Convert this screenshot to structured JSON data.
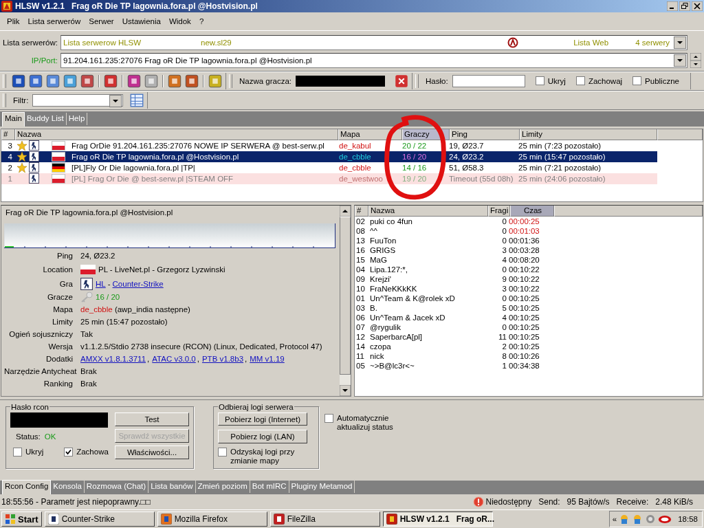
{
  "window": {
    "title": "HLSW v1.2.1   Frag oR Die TP lagownia.fora.pl @Hostvision.pl"
  },
  "menu": [
    {
      "label": "Plik"
    },
    {
      "label": "Lista serwerów"
    },
    {
      "label": "Serwer"
    },
    {
      "label": "Ustawienia"
    },
    {
      "label": "Widok"
    },
    {
      "label": "?"
    }
  ],
  "server_list": {
    "label": "Lista serwerów:",
    "name": "Lista serwerow HLSW",
    "file": "new.sl29",
    "source": "Lista Web",
    "count": "4 serwery"
  },
  "ip_port": {
    "label": "IP/Port:",
    "value": "91.204.161.235:27076 Frag oR Die TP lagownia.fora.pl @Hostvision.pl"
  },
  "toolbar": {
    "player_name_label": "Nazwa gracza:",
    "password_label": "Hasło:",
    "checkboxes": [
      {
        "label": "Ukryj",
        "checked": false
      },
      {
        "label": "Zachowaj",
        "checked": false
      },
      {
        "label": "Publiczne",
        "checked": false
      }
    ]
  },
  "filter": {
    "label": "Filtr:"
  },
  "main_tabs": [
    {
      "label": "Main",
      "selected": true
    },
    {
      "label": "Buddy List",
      "selected": false
    },
    {
      "label": "Help",
      "selected": false
    }
  ],
  "servers": {
    "columns": [
      {
        "label": "#",
        "sorted": false
      },
      {
        "label": "Nazwa",
        "sorted": false
      },
      {
        "label": "Mapa",
        "sorted": false
      },
      {
        "label": "Graczy",
        "sorted": true
      },
      {
        "label": "Ping",
        "sorted": false
      },
      {
        "label": "Limity",
        "sorted": false
      }
    ],
    "rows": [
      {
        "num": "3",
        "favorite": true,
        "flag": {
          "kind": "pl"
        },
        "name": "Frag OrDie 91.204.161.235:27076 NOWE IP SERWERA @ best-serw.pl",
        "map": "de_kabul",
        "players": "20 / 22",
        "ping": "19, Ø23.7",
        "limits": "25 min (7:23 pozostało)",
        "selected": false,
        "timeout": false
      },
      {
        "num": "4",
        "favorite": true,
        "flag": {
          "kind": "pl"
        },
        "name": "Frag oR Die TP lagownia.fora.pl @Hostvision.pl",
        "map": "de_cbble",
        "players": "16 / 20",
        "ping": "24, Ø23.2",
        "limits": "25 min (15:47 pozostało)",
        "selected": true,
        "timeout": false
      },
      {
        "num": "2",
        "favorite": true,
        "flag": {
          "kind": "de"
        },
        "name": "[PL]Fly Or Die lagownia.fora.pl |TP|",
        "map": "de_cbble",
        "players": "14 / 16",
        "ping": "51, Ø58.3",
        "limits": "25 min (7:21 pozostało)",
        "selected": false,
        "timeout": false
      },
      {
        "num": "1",
        "favorite": false,
        "flag": {
          "kind": "pl"
        },
        "name": "[PL] Frag Or Die @ best-serw.pl |STEAM OFF",
        "map": "de_westwoo",
        "players": "19 / 20",
        "ping": "Timeout (55d 08h)",
        "limits": "25 min (24:06 pozostało)",
        "selected": false,
        "timeout": true
      }
    ]
  },
  "details": {
    "title": "Frag oR Die TP lagownia.fora.pl @Hostvision.pl",
    "fields": [
      {
        "kind": "text",
        "label": "Ping",
        "value": "24, Ø23.2"
      },
      {
        "kind": "location",
        "label": "Location",
        "value": "PL - LiveNet.pl - Grzegorz Lyzwinski"
      },
      {
        "kind": "game",
        "label": "Gra",
        "links": [
          "HL",
          "Counter-Strike"
        ],
        "separator": "-"
      },
      {
        "kind": "players",
        "label": "Gracze",
        "value": "16 / 20"
      },
      {
        "kind": "map",
        "label": "Mapa",
        "map": "de_cbble",
        "value": "(awp_india następne)"
      },
      {
        "kind": "text",
        "label": "Limity",
        "value": "25 min (15:47 pozostało)"
      },
      {
        "kind": "text",
        "label": "Ogień sojuszniczy",
        "value": "Tak"
      },
      {
        "kind": "text",
        "label": "Wersja",
        "value": "v1.1.2.5/Stdio 2738 insecure (RCON) (Linux, Dedicated, Protocol 47)"
      },
      {
        "kind": "addons",
        "label": "Dodatki",
        "links": [
          "AMXX v1.8.1.3711",
          "ATAC v3.0.0",
          "PTB v1.8b3",
          "MM v1.19"
        ],
        "separator": ","
      },
      {
        "kind": "text",
        "label": "Narzędzie Antycheat",
        "value": "Brak"
      },
      {
        "kind": "text",
        "label": "Ranking",
        "value": "Brak"
      }
    ]
  },
  "players": {
    "columns": [
      {
        "label": "#",
        "sorted": false
      },
      {
        "label": "Nazwa",
        "sorted": false
      },
      {
        "label": "Fragi",
        "sorted": false
      },
      {
        "label": "Czas",
        "sorted": true
      }
    ],
    "rows": [
      {
        "id": "02",
        "name": "puki co 4fun",
        "frags": "0",
        "time": "00:00:25",
        "new": true
      },
      {
        "id": "08",
        "name": "^^",
        "frags": "0",
        "time": "00:01:03",
        "new": true
      },
      {
        "id": "13",
        "name": "FuuTon",
        "frags": "0",
        "time": "00:01:36",
        "new": false
      },
      {
        "id": "16",
        "name": "GRIGS",
        "frags": "3",
        "time": "00:03:28",
        "new": false
      },
      {
        "id": "15",
        "name": "MaG",
        "frags": "4",
        "time": "00:08:20",
        "new": false
      },
      {
        "id": "04",
        "name": "Lipa.127:*,",
        "frags": "0",
        "time": "00:10:22",
        "new": false
      },
      {
        "id": "09",
        "name": "Krejzi'",
        "frags": "9",
        "time": "00:10:22",
        "new": false
      },
      {
        "id": "10",
        "name": "FraNeKKkKK",
        "frags": "3",
        "time": "00:10:22",
        "new": false
      },
      {
        "id": "01",
        "name": "Un^Team & K@rolek xD",
        "frags": "0",
        "time": "00:10:25",
        "new": false
      },
      {
        "id": "03",
        "name": "B.",
        "frags": "5",
        "time": "00:10:25",
        "new": false
      },
      {
        "id": "06",
        "name": "Un^Team & Jacek xD",
        "frags": "4",
        "time": "00:10:25",
        "new": false
      },
      {
        "id": "07",
        "name": "@rygulik",
        "frags": "0",
        "time": "00:10:25",
        "new": false
      },
      {
        "id": "12",
        "name": "SaperbarcA[pl]",
        "frags": "11",
        "time": "00:10:25",
        "new": false
      },
      {
        "id": "14",
        "name": "czopa",
        "frags": "2",
        "time": "00:10:25",
        "new": false
      },
      {
        "id": "11",
        "name": "nick",
        "frags": "8",
        "time": "00:10:26",
        "new": false
      },
      {
        "id": "05",
        "name": "~>B@lc3r<~",
        "frags": "1",
        "time": "00:34:38",
        "new": false
      }
    ]
  },
  "rcon": {
    "title": "Hasło rcon",
    "status_label": "Status:",
    "status": "OK",
    "buttons": [
      {
        "label": "Test",
        "disabled": false
      },
      {
        "label": "Sprawdź wszystkie",
        "disabled": true
      },
      {
        "label": "Właściwości...",
        "disabled": false
      }
    ],
    "checkboxes": [
      {
        "label": "Ukryj",
        "checked": false
      },
      {
        "label": "Zachowa",
        "checked": true
      }
    ]
  },
  "logs": {
    "title": "Odbieraj logi serwera",
    "buttons": [
      {
        "label": "Pobierz logi (Internet)"
      },
      {
        "label": "Pobierz logi (LAN)"
      }
    ],
    "checkbox": {
      "label": "Odzyskaj logi przy zmianie mapy",
      "checked": false
    }
  },
  "auto_update": {
    "label": "Automatycznie aktualizuj status",
    "checked": false
  },
  "bottom_tabs": [
    {
      "label": "Rcon Config",
      "selected": true
    },
    {
      "label": "Konsola",
      "selected": false
    },
    {
      "label": "Rozmowa (Chat)",
      "selected": false
    },
    {
      "label": "Lista banów",
      "selected": false
    },
    {
      "label": "Zmień poziom",
      "selected": false
    },
    {
      "label": "Bot mIRC",
      "selected": false
    },
    {
      "label": "Pluginy Metamod",
      "selected": false
    }
  ],
  "status_bar": {
    "message": "18:55:56 - Parametr jest niepoprawny.□□",
    "connection": "Niedostępny",
    "send_label": "Send:",
    "send": "95 Bajtów/s",
    "receive_label": "Receive:",
    "receive": "2.48 KiB/s"
  },
  "taskbar": {
    "start": "Start",
    "tasks": [
      {
        "label": "Counter-Strike",
        "selected": false
      },
      {
        "label": "Mozilla Firefox",
        "selected": false
      },
      {
        "label": "FileZilla",
        "selected": false
      },
      {
        "label": "HLSW v1.2.1   Frag oR...",
        "selected": true
      }
    ],
    "tray_toggle": "«",
    "clock": "18:58"
  }
}
